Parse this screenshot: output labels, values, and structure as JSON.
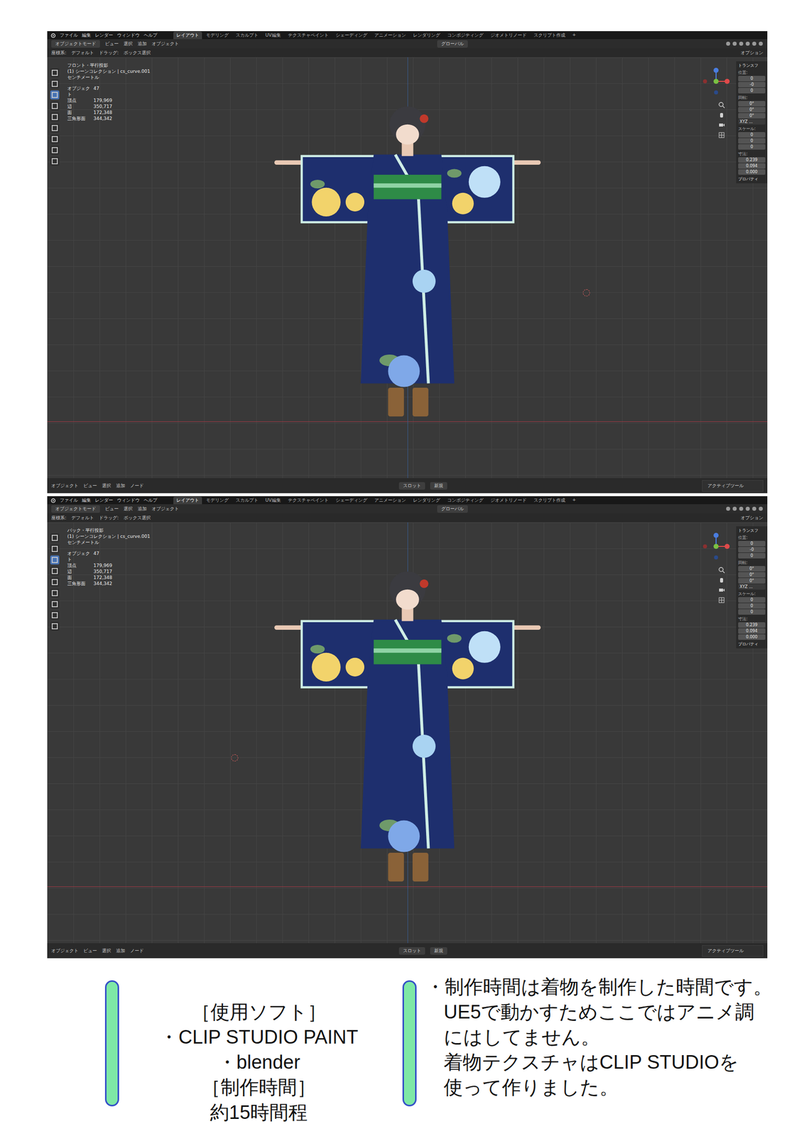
{
  "screenshots": [
    {
      "menu": [
        "ファイル",
        "編集",
        "レンダー",
        "ウィンドウ",
        "ヘルプ"
      ],
      "workspace_tabs": [
        {
          "label": "レイアウト",
          "selected": true
        },
        {
          "label": "モデリング",
          "selected": false
        },
        {
          "label": "スカルプト",
          "selected": false
        },
        {
          "label": "UV編集",
          "selected": false
        },
        {
          "label": "テクスチャペイント",
          "selected": false
        },
        {
          "label": "シェーディング",
          "selected": false
        },
        {
          "label": "アニメーション",
          "selected": false
        },
        {
          "label": "レンダリング",
          "selected": false
        },
        {
          "label": "コンポジティング",
          "selected": false
        },
        {
          "label": "ジオメトリノード",
          "selected": false
        },
        {
          "label": "スクリプト作成",
          "selected": false
        },
        {
          "label": "+",
          "selected": false
        }
      ],
      "header": {
        "mode": "オブジェクトモード",
        "items": [
          "ビュー",
          "選択",
          "追加",
          "オブジェクト"
        ],
        "pivot": "グローバル"
      },
      "tool_header": {
        "items": [
          "座標系:",
          "デフォルト",
          "ドラッグ:",
          "ボックス選択"
        ],
        "options": "オプション"
      },
      "overlay": {
        "view": "フロント・平行投影",
        "collection": "(1) シーンコレクション | cs_curve.001",
        "units": "センチメートル",
        "stats": [
          {
            "label": "オブジェクト",
            "value": "47"
          },
          {
            "label": "頂点",
            "value": "179,969"
          },
          {
            "label": "辺",
            "value": "350,717"
          },
          {
            "label": "面",
            "value": "172,348"
          },
          {
            "label": "三角形面",
            "value": "344,342"
          }
        ]
      },
      "n_panel": {
        "section": "トランスフ",
        "groups": [
          {
            "label": "位置:",
            "values": [
              "0",
              "-0",
              "0"
            ]
          },
          {
            "label": "回転:",
            "values": [
              "0°",
              "0°",
              "0°"
            ],
            "mode": "XYZ ..."
          },
          {
            "label": "スケール:",
            "values": [
              "0",
              "0",
              "0"
            ]
          },
          {
            "label": "寸法:",
            "values": [
              "0.239",
              "0.094",
              "0.000"
            ]
          }
        ],
        "footer": "プロパティ"
      },
      "status_bar": {
        "items": [
          "オブジェクト",
          "ビュー",
          "選択",
          "追加",
          "ノード"
        ],
        "slot": "スロット",
        "new": "新規",
        "active_tool": "アクティブツール"
      }
    },
    {
      "menu": [
        "ファイル",
        "編集",
        "レンダー",
        "ウィンドウ",
        "ヘルプ"
      ],
      "workspace_tabs": [
        {
          "label": "レイアウト",
          "selected": true
        },
        {
          "label": "モデリング",
          "selected": false
        },
        {
          "label": "スカルプト",
          "selected": false
        },
        {
          "label": "UV編集",
          "selected": false
        },
        {
          "label": "テクスチャペイント",
          "selected": false
        },
        {
          "label": "シェーディング",
          "selected": false
        },
        {
          "label": "アニメーション",
          "selected": false
        },
        {
          "label": "レンダリング",
          "selected": false
        },
        {
          "label": "コンポジティング",
          "selected": false
        },
        {
          "label": "ジオメトリノード",
          "selected": false
        },
        {
          "label": "スクリプト作成",
          "selected": false
        },
        {
          "label": "+",
          "selected": false
        }
      ],
      "header": {
        "mode": "オブジェクトモード",
        "items": [
          "ビュー",
          "選択",
          "追加",
          "オブジェクト"
        ],
        "pivot": "グローバル"
      },
      "tool_header": {
        "items": [
          "座標系:",
          "デフォルト",
          "ドラッグ:",
          "ボックス選択"
        ],
        "options": "オプション"
      },
      "overlay": {
        "view": "バック・平行投影",
        "collection": "(1) シーンコレクション | cs_curve.001",
        "units": "センチメートル",
        "stats": [
          {
            "label": "オブジェクト",
            "value": "47"
          },
          {
            "label": "頂点",
            "value": "179,969"
          },
          {
            "label": "辺",
            "value": "350,717"
          },
          {
            "label": "面",
            "value": "172,348"
          },
          {
            "label": "三角形面",
            "value": "344,342"
          }
        ]
      },
      "n_panel": {
        "section": "トランスフ",
        "groups": [
          {
            "label": "位置:",
            "values": [
              "0",
              "-0",
              "0"
            ]
          },
          {
            "label": "回転:",
            "values": [
              "0°",
              "0°",
              "0°"
            ],
            "mode": "XYZ ..."
          },
          {
            "label": "スケール:",
            "values": [
              "0",
              "0",
              "0"
            ]
          },
          {
            "label": "寸法:",
            "values": [
              "0.239",
              "0.094",
              "0.000"
            ]
          }
        ],
        "footer": "プロパティ"
      },
      "status_bar": {
        "items": [
          "オブジェクト",
          "ビュー",
          "選択",
          "追加",
          "ノード"
        ],
        "slot": "スロット",
        "new": "新規",
        "active_tool": "アクティブツール"
      }
    }
  ],
  "info": {
    "left": [
      "［使用ソフト］",
      "・CLIP STUDIO PAINT",
      "・blender",
      "［制作時間］",
      "約15時間程"
    ],
    "right": [
      "・制作時間は着物を制作した時間です。",
      "UE5で動かすためここではアニメ調",
      "にはしてません。",
      "着物テクスチャはCLIP STUDIOを",
      "使って作りました。"
    ]
  }
}
